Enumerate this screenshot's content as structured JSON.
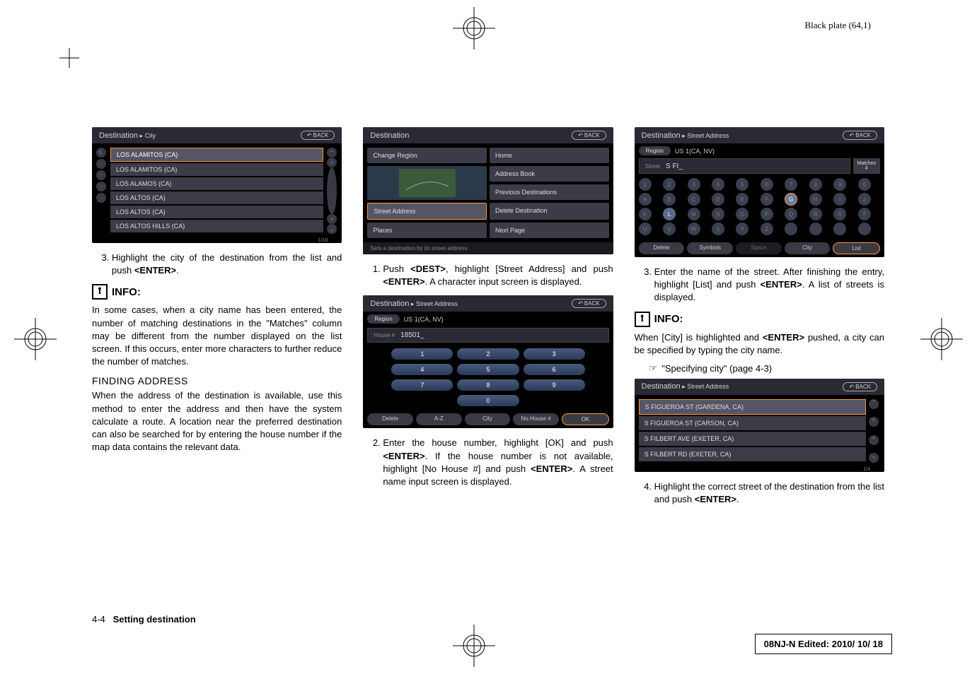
{
  "header": {
    "plate": "Black plate (64,1)"
  },
  "footer": {
    "page": "4-4",
    "section": "Setting destination"
  },
  "stamp": "08NJ-N Edited:  2010/ 10/ 18",
  "col1": {
    "ss1": {
      "title": "Destination",
      "crumb": "City",
      "back": "BACK",
      "items": [
        "LOS ALAMITOS (CA)",
        "LOS ALAMITOS (CA)",
        "LOS ALAMOS (CA)",
        "LOS ALTOS (CA)",
        "LOS ALTOS (CA)",
        "LOS ALTOS HILLS (CA)"
      ],
      "page": "1/18"
    },
    "step3": "Highlight the city of the destination from the list and push <ENTER>.",
    "info_label": "INFO:",
    "info_text": "In some cases, when a city name has been entered, the number of matching destinations in the \"Matches\" column may be different from the number displayed on the list screen. If this occurs, enter more characters to further reduce the number of matches.",
    "heading": "FINDING ADDRESS",
    "para": "When the address of the destination is available, use this method to enter the address and then have the system calculate a route. A location near the preferred destination can also be searched for by entering the house number if the map data contains the relevant data."
  },
  "col2": {
    "ss1": {
      "title": "Destination",
      "back": "BACK",
      "left": [
        "Change Region",
        "Street Address",
        "Places"
      ],
      "right": [
        "Home",
        "Address Book",
        "Previous Destinations",
        "Delete Destination",
        "Next Page"
      ],
      "footer": "Sets a destination by its street address"
    },
    "step1": "Push <DEST>, highlight [Street Address] and push <ENTER>. A character input screen is displayed.",
    "ss2": {
      "title": "Destination",
      "crumb": "Street Address",
      "back": "BACK",
      "region_label": "Region",
      "region_val": "US 1(CA, NV)",
      "house_label": "House #",
      "house_val": "18501_",
      "keys": [
        "1",
        "2",
        "3",
        "4",
        "5",
        "6",
        "7",
        "8",
        "9",
        "0"
      ],
      "bottom": [
        "Delete",
        "A-Z",
        "City",
        "No House #",
        "OK"
      ]
    },
    "step2": "Enter the house number, highlight [OK] and push <ENTER>. If the house number is not available, highlight [No House #] and push <ENTER>. A street name input screen is displayed."
  },
  "col3": {
    "ss1": {
      "title": "Destination",
      "crumb": "Street Address",
      "back": "BACK",
      "region_label": "Region",
      "region_val": "US 1(CA, NV)",
      "street_label": "Street",
      "street_val": "S FI_",
      "matches_label": "Matches",
      "matches_val": "4",
      "bottom": [
        "Delete",
        "Symbols",
        "Space",
        "City",
        "List"
      ]
    },
    "step3": "Enter the name of the street. After finishing the entry, highlight [List] and push <ENTER>. A list of streets is displayed.",
    "info_label": "INFO:",
    "info_text": "When [City] is highlighted and <ENTER> pushed, a city can be specified by typing the city name.",
    "xref": "\"Specifying city\" (page 4-3)",
    "ss2": {
      "title": "Destination",
      "crumb": "Street Address",
      "back": "BACK",
      "items": [
        "S FIGUEROA ST (GARDENA, CA)",
        "S FIGUEROA ST (CARSON, CA)",
        "S FILBERT AVE (EXETER, CA)",
        "S FILBERT RD (EXETER, CA)"
      ],
      "page": "1/4"
    },
    "step4": "Highlight the correct street of the destination from the list and push <ENTER>."
  }
}
